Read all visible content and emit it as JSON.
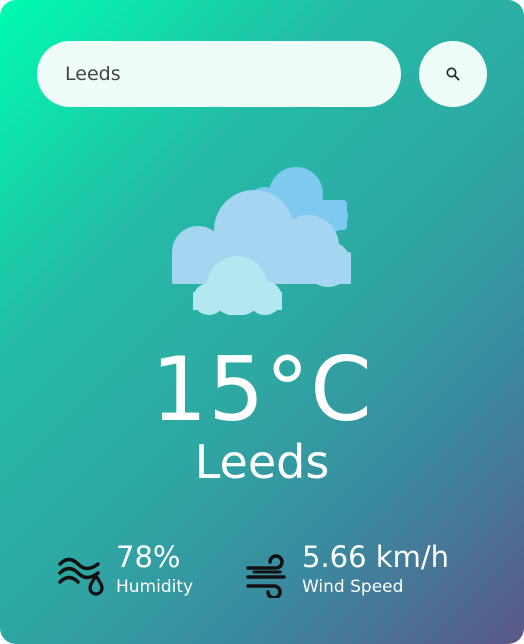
{
  "search": {
    "value": "Leeds",
    "button_icon": "search-icon"
  },
  "weather": {
    "icon": "clouds-icon",
    "temperature": "15°C",
    "city": "Leeds"
  },
  "details": {
    "humidity": {
      "icon": "humidity-icon",
      "value": "78%",
      "label": "Humidity"
    },
    "wind": {
      "icon": "wind-icon",
      "value": "5.66 km/h",
      "label": "Wind Speed"
    }
  },
  "colors": {
    "gradient_start": "#00fcb0",
    "gradient_end": "#5b5889",
    "input_bg": "#eefdf8"
  }
}
